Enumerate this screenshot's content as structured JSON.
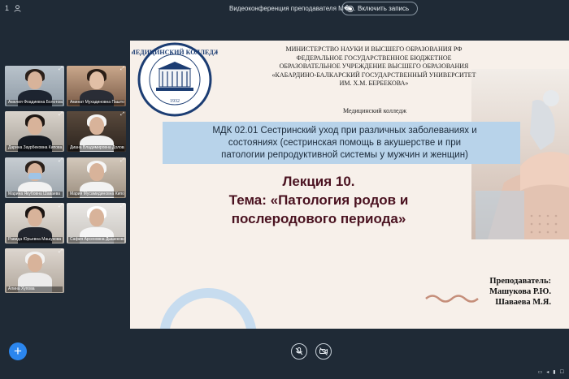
{
  "topbar": {
    "counter": "1",
    "conference_title": "Видеоконференция преподавателя М�...",
    "record_label": "Включить запись"
  },
  "participants": [
    {
      "name": "Амелия Фоадиевна Болотова"
    },
    {
      "name": "Аминат Мухадиновна Паштова"
    },
    {
      "name": "Дарина Заурбековна Кипова"
    },
    {
      "name": "Диана Владимировна Долова"
    },
    {
      "name": "Марина Якубовна Шаваева"
    },
    {
      "name": "Мария Мусамидиновна Кипова"
    },
    {
      "name": "Равида Юрьевна Машукова"
    },
    {
      "name": "Сафия Арсеновна Дышекова"
    },
    {
      "name": "Алина Хупова"
    }
  ],
  "slide": {
    "logo_text": "МЕДИЦИНСКИЙ КОЛЛЕДЖ",
    "logo_year": "1932",
    "ministry_lines": [
      "МИНИСТЕРСТВО НАУКИ И ВЫСШЕГО ОБРАЗОВАНИЯ РФ",
      "ФЕДЕРАЛЬНОЕ ГОСУДАРСТВЕННОЕ БЮДЖЕТНОЕ",
      "ОБРАЗОВАТЕЛЬНОЕ УЧРЕЖДЕНИЕ ВЫСШЕГО ОБРАЗОВАНИЯ",
      "«КАБАРДИНО-БАЛКАРСКИЙ ГОСУДАРСТВЕННЫЙ УНИВЕРСИТЕТ",
      "ИМ. Х.М. БЕРБЕКОВА»"
    ],
    "college": "Медицинский колледж",
    "module_lines": [
      "МДК 02.01 Сестринский уход при различных заболеваниях и",
      "состояниях (сестринская помощь в акушерстве и при",
      "патологии репродуктивной системы у мужчин и женщин)"
    ],
    "lecture_lines": [
      "Лекция 10.",
      "Тема: «Патология родов и",
      "послеродового периода»"
    ],
    "teacher_label": "Преподаватель:",
    "teachers": [
      "Машукова Р.Ю.",
      "Шаваева М.Я."
    ]
  },
  "controls": {
    "add_icon": "plus-icon",
    "mic_icon": "microphone-muted-icon",
    "camera_icon": "camera-off-icon"
  },
  "colors": {
    "background": "#1f2a36",
    "accent": "#2b86ee",
    "slide_band": "#b8d3ea",
    "lecture_title": "#4a1220"
  }
}
